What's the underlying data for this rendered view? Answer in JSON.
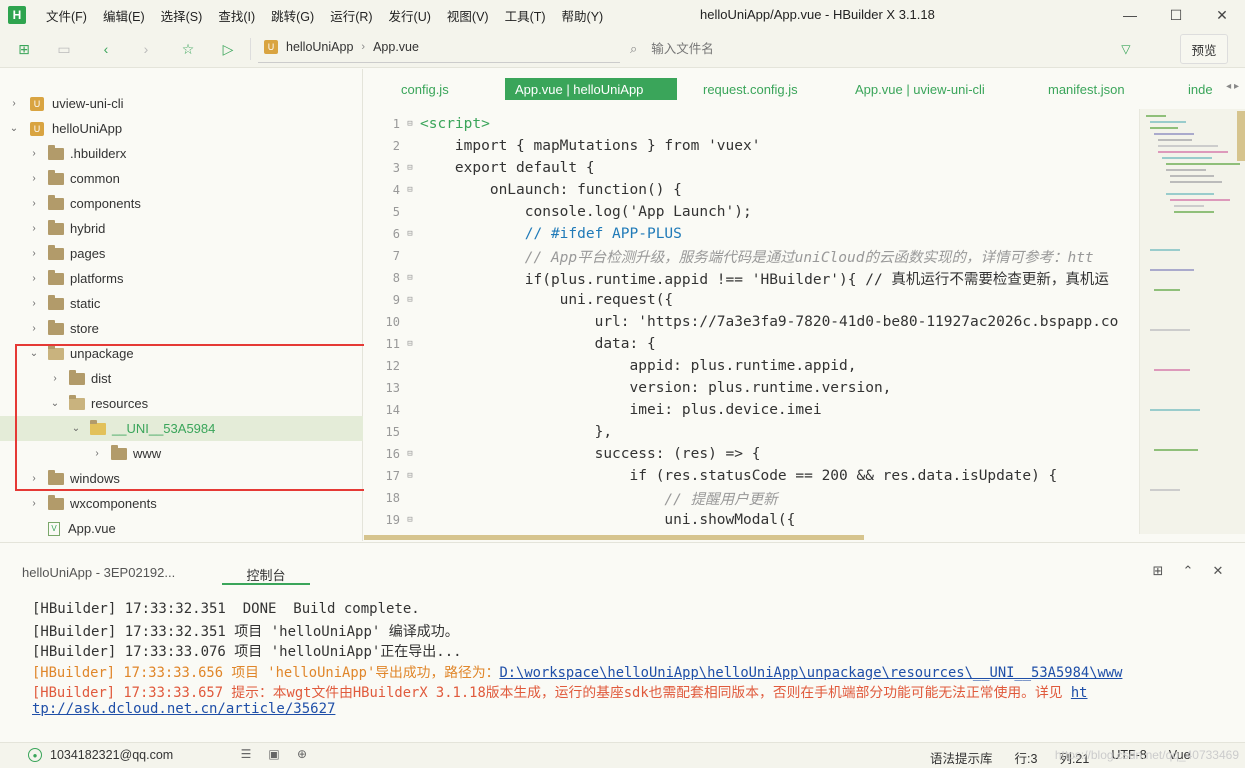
{
  "app": {
    "logo": "H",
    "title": "helloUniApp/App.vue - HBuilder X 3.1.18",
    "menu": [
      "文件(F)",
      "编辑(E)",
      "选择(S)",
      "查找(I)",
      "跳转(G)",
      "运行(R)",
      "发行(U)",
      "视图(V)",
      "工具(T)",
      "帮助(Y)"
    ],
    "window_controls": {
      "minimize": "—",
      "maximize": "☐",
      "close": "✕"
    }
  },
  "toolbar": {
    "breadcrumb": [
      "helloUniApp",
      "App.vue"
    ],
    "search_placeholder": "输入文件名",
    "preview_label": "预览"
  },
  "sidebar": {
    "items": [
      {
        "label": "uview-uni-cli",
        "type": "project",
        "expanded": false
      },
      {
        "label": "helloUniApp",
        "type": "project",
        "expanded": true
      },
      {
        "label": ".hbuilderx",
        "type": "folder"
      },
      {
        "label": "common",
        "type": "folder"
      },
      {
        "label": "components",
        "type": "folder"
      },
      {
        "label": "hybrid",
        "type": "folder"
      },
      {
        "label": "pages",
        "type": "folder"
      },
      {
        "label": "platforms",
        "type": "folder"
      },
      {
        "label": "static",
        "type": "folder"
      },
      {
        "label": "store",
        "type": "folder"
      },
      {
        "label": "unpackage",
        "type": "folder",
        "expanded": true
      },
      {
        "label": "dist",
        "type": "folder"
      },
      {
        "label": "resources",
        "type": "folder",
        "expanded": true
      },
      {
        "label": "__UNI__53A5984",
        "type": "folder",
        "expanded": true,
        "selected": true
      },
      {
        "label": "www",
        "type": "folder"
      },
      {
        "label": "windows",
        "type": "folder"
      },
      {
        "label": "wxcomponents",
        "type": "folder"
      },
      {
        "label": "App.vue",
        "type": "file"
      }
    ]
  },
  "editor": {
    "tabs": [
      {
        "label": "config.js",
        "active": false
      },
      {
        "label": "App.vue | helloUniApp",
        "active": true
      },
      {
        "label": "request.config.js",
        "active": false
      },
      {
        "label": "App.vue | uview-uni-cli",
        "active": false
      },
      {
        "label": "manifest.json",
        "active": false
      },
      {
        "label": "inde",
        "active": false
      }
    ],
    "lines": [
      {
        "n": "1",
        "text": "<script>"
      },
      {
        "n": "2",
        "text": "    import { mapMutations } from 'vuex'"
      },
      {
        "n": "3",
        "text": "    export default {"
      },
      {
        "n": "4",
        "text": "        onLaunch: function() {"
      },
      {
        "n": "5",
        "text": "            console.log('App Launch');"
      },
      {
        "n": "6",
        "text": "            // #ifdef APP-PLUS"
      },
      {
        "n": "7",
        "text": "            // App平台检测升级，服务端代码是通过uniCloud的云函数实现的，详情可参考：htt"
      },
      {
        "n": "8",
        "text": "            if(plus.runtime.appid !== 'HBuilder'){ // 真机运行不需要检查更新，真机运"
      },
      {
        "n": "9",
        "text": "                uni.request({"
      },
      {
        "n": "10",
        "text": "                    url: 'https://7a3e3fa9-7820-41d0-be80-11927ac2026c.bspapp.co"
      },
      {
        "n": "11",
        "text": "                    data: {"
      },
      {
        "n": "12",
        "text": "                        appid: plus.runtime.appid,"
      },
      {
        "n": "13",
        "text": "                        version: plus.runtime.version,"
      },
      {
        "n": "14",
        "text": "                        imei: plus.device.imei"
      },
      {
        "n": "15",
        "text": "                    },"
      },
      {
        "n": "16",
        "text": "                    success: (res) => {"
      },
      {
        "n": "17",
        "text": "                        if (res.statusCode == 200 && res.data.isUpdate) {"
      },
      {
        "n": "18",
        "text": "                            // 提醒用户更新"
      },
      {
        "n": "19",
        "text": "                            uni.showModal({"
      }
    ]
  },
  "console": {
    "tab_project": "helloUniApp - 3EP02192...",
    "tab_console": "控制台",
    "logs": [
      {
        "level": "info",
        "prefix": "[HBuilder] 17:33:32.351",
        "text": "  DONE  Build complete."
      },
      {
        "level": "info",
        "prefix": "[HBuilder] 17:33:32.351",
        "text": " 项目 'helloUniApp' 编译成功。"
      },
      {
        "level": "info",
        "prefix": "[HBuilder] 17:33:33.076",
        "text": " 项目 'helloUniApp'正在导出..."
      },
      {
        "level": "warn",
        "prefix": "[HBuilder] 17:33:33.656",
        "text": " 项目 'helloUniApp'导出成功，路径为：",
        "path": "D:\\workspace\\helloUniApp\\helloUniApp\\unpackage\\resources\\__UNI__53A5984\\www"
      },
      {
        "level": "err",
        "prefix": "[HBuilder] 17:33:33.657",
        "text": " 提示：本wgt文件由HBuilderX 3.1.18版本生成，运行的基座sdk也需配套相同版本，否则在手机端部分功能可能无法正常使用。详见 ",
        "link_start": "ht"
      },
      {
        "level": "link",
        "text": "tp://ask.dcloud.net.cn/article/35627"
      }
    ]
  },
  "statusbar": {
    "user": "1034182321@qq.com",
    "hint": "语法提示库",
    "line": "行:3",
    "col": "列:21",
    "encoding": "UTF-8",
    "language": "Vue",
    "watermark": "https://blog.csdn.net/qq_40733469"
  }
}
